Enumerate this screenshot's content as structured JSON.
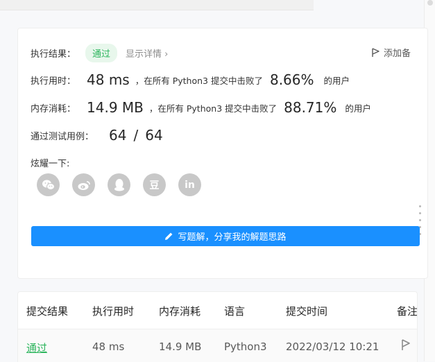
{
  "result": {
    "label": "执行结果：",
    "status": "通过",
    "details_link": "显示详情 ›",
    "add_note": "添加备"
  },
  "runtime": {
    "label": "执行用时：",
    "value": "48 ms",
    "text": "，在所有 Python3 提交中击败了",
    "percent": "8.66%",
    "suffix": "的用户"
  },
  "memory": {
    "label": "内存消耗：",
    "value": "14.9 MB",
    "text": "，在所有 Python3 提交中击败了",
    "percent": "88.71%",
    "suffix": "的用户"
  },
  "tests": {
    "label": "通过测试用例：",
    "passed": "64",
    "sep": "/",
    "total": "64"
  },
  "share": {
    "label": "炫耀一下:",
    "icons": [
      "wechat-icon",
      "weibo-icon",
      "qq-icon",
      "douban-icon",
      "linkedin-icon"
    ],
    "douban_glyph": "豆",
    "linkedin_glyph": "in"
  },
  "write_button": "写题解，分享我的解题思路",
  "table": {
    "headers": [
      "提交结果",
      "执行用时",
      "内存消耗",
      "语言",
      "提交时间",
      "备注"
    ],
    "row": {
      "status": "通过",
      "runtime": "48 ms",
      "memory": "14.9 MB",
      "language": "Python3",
      "time": "2022/03/12 10:21"
    }
  },
  "colors": {
    "accent": "#1a90ff",
    "success": "#2db55d",
    "icon_gray": "#c8c8c8"
  }
}
